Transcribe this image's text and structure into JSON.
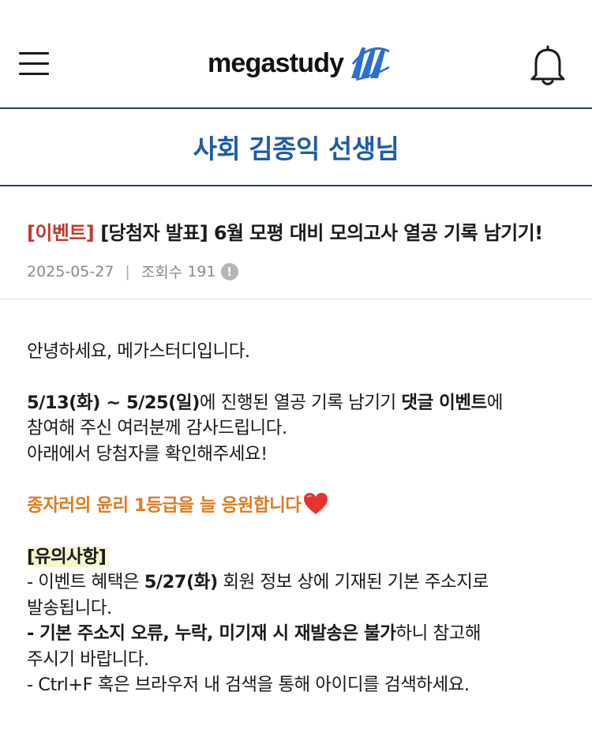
{
  "header": {
    "logo_text": "megastudy",
    "menu_icon": "hamburger-menu-icon",
    "bell_icon": "bell-icon"
  },
  "teacher": {
    "name": "사회 김종익 선생님"
  },
  "post": {
    "tag": "[이벤트]",
    "title": "[당첨자 발표] 6월 모평 대비 모의고사 열공 기록 남기기!",
    "date": "2025-05-27",
    "separator": "|",
    "views_label": "조회수",
    "views": "191"
  },
  "body": {
    "greeting": "안녕하세요, 메가스터디입니다.",
    "p1_bold1": "5/13(화) ~ 5/25(일)",
    "p1_text1": "에 진행된 열공 기록 남기기 ",
    "p1_bold2": "댓글 이벤트",
    "p1_text2": "에",
    "p1_line2": "참여해 주신 여러분께 감사드립니다.",
    "p1_line3": "아래에서 당첨자를 확인해주세요!",
    "cheer": "종자러의 윤리 1등급을 늘 응원합니다",
    "cheer_icon": "red-heart-icon",
    "notice_heading": "[유의사항]",
    "n1_text1": "- 이벤트 혜택은 ",
    "n1_bold": "5/27(화)",
    "n1_text2": " 회원 정보 상에 기재된 기본 주소지로",
    "n1_line2": "발송됩니다.",
    "n2_bold": "- 기본 주소지 오류, 누락, 미기재 시 재발송은 불가",
    "n2_text": "하니 참고해",
    "n2_line2": "주시기 바랍니다.",
    "n3": "- Ctrl+F 혹은 브라우저 내 검색을 통해 아이디를 검색하세요."
  },
  "colors": {
    "brand_blue": "#1d5da8",
    "tag_red": "#c0392b",
    "cheer_orange": "#e07b20",
    "highlight": "#f6f7cf"
  }
}
